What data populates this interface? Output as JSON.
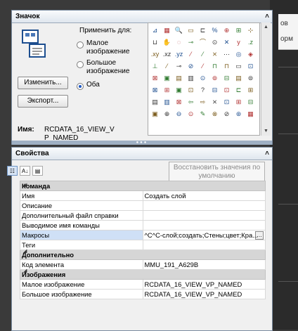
{
  "icon_panel": {
    "title": "Значок",
    "apply_label": "Применить для:",
    "radios": [
      {
        "line1": "Малое",
        "line2": "изображение",
        "selected": false
      },
      {
        "line1": "Большое",
        "line2": "изображение",
        "selected": false
      },
      {
        "line1": "Оба",
        "line2": "",
        "selected": true
      }
    ],
    "edit_button": "Изменить...",
    "export_button": "Экспорт...",
    "name_label": "Имя:",
    "name_value": "RCDATA_16_VIEW_VP_NAMED",
    "grid_icons": [
      "⊿",
      "▦",
      "🔍",
      "▭",
      "⊏",
      "%",
      "⊕",
      "⊞",
      "⊹",
      "⊔",
      "✋",
      "◌",
      "⊸",
      "⌒",
      "⊙",
      "✕",
      "y",
      ".z",
      ".xy",
      ".xz",
      ".yz",
      "⁄",
      "⁄",
      "⨯",
      "⋯",
      "◎",
      "◈",
      "⊥",
      "⁄",
      "⊸",
      "⊘",
      "⁄",
      "⊓",
      "⊓",
      "▭",
      "⊡",
      "⊠",
      "▣",
      "▤",
      "▥",
      "⊙",
      "⊚",
      "⊟",
      "▤",
      "⊜",
      "⊠",
      "⊞",
      "▣",
      "⊡",
      "?",
      "⊟",
      "⊡",
      "⊏",
      "⊞",
      "▤",
      "▥",
      "⊠",
      "⇦",
      "⇨",
      "⨯",
      "⊡",
      "⊞",
      "⊟",
      "▣",
      "⊕",
      "⊖",
      "⊙",
      "✎",
      "⊗",
      "⊘",
      "⊛",
      "▦"
    ]
  },
  "properties_panel": {
    "title": "Свойства",
    "restore_button": "Восстановить значения по умолчанию",
    "categories": [
      {
        "name": "Команда",
        "rows": [
          {
            "key": "Имя",
            "value": "Создать слой"
          },
          {
            "key": "Описание",
            "value": ""
          },
          {
            "key": "Дополнительный файл справки",
            "value": ""
          },
          {
            "key": "Выводимое имя команды",
            "value": ""
          },
          {
            "key": "Макросы",
            "value": "^C^C-слой;создать;Стены;цвет;Кра..."
          },
          {
            "key": "Теги",
            "value": ""
          }
        ]
      },
      {
        "name": "Дополнительно",
        "rows": [
          {
            "key": "Код элемента",
            "value": "MMU_191_A629B"
          }
        ]
      },
      {
        "name": "Изображения",
        "rows": [
          {
            "key": "Малое изображение",
            "value": "RCDATA_16_VIEW_VP_NAMED"
          },
          {
            "key": "Большое изображение",
            "value": "RCDATA_16_VIEW_VP_NAMED"
          }
        ]
      }
    ]
  },
  "backdrop": {
    "text1": "ов",
    "text2": "орм"
  }
}
